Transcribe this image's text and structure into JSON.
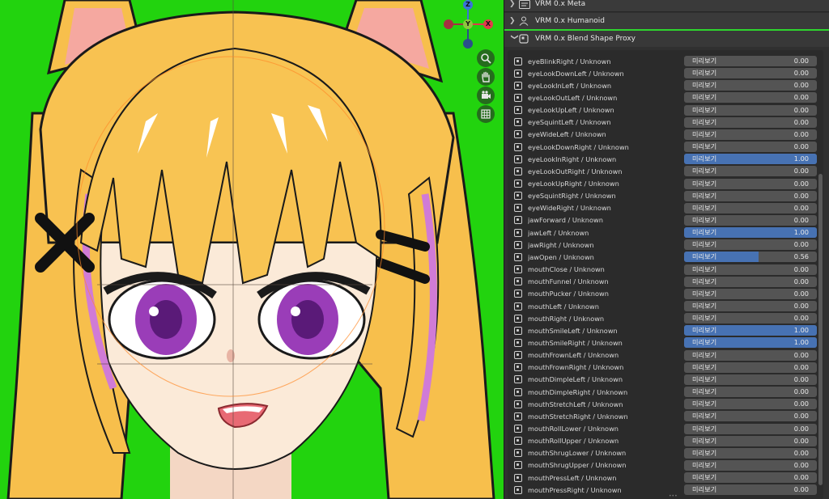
{
  "sections": [
    {
      "label": "VRM 0.x Meta",
      "expanded": false,
      "icon": "vrm-meta-icon"
    },
    {
      "label": "VRM 0.x Humanoid",
      "expanded": false,
      "icon": "humanoid-icon"
    },
    {
      "label": "VRM 0.x Blend Shape Proxy",
      "expanded": true,
      "icon": "blend-shape-icon"
    }
  ],
  "gizmo": {
    "z": "Z",
    "y": "Y",
    "x": "X"
  },
  "viewport_tools": [
    "zoom-icon",
    "hand-pan-icon",
    "camera-icon",
    "grid-icon"
  ],
  "slider_label": "미리보기",
  "blend_shapes": [
    {
      "name": "eyeBlinkRight / Unknown",
      "value": "0.00"
    },
    {
      "name": "eyeLookDownLeft / Unknown",
      "value": "0.00"
    },
    {
      "name": "eyeLookInLeft / Unknown",
      "value": "0.00"
    },
    {
      "name": "eyeLookOutLeft / Unknown",
      "value": "0.00"
    },
    {
      "name": "eyeLookUpLeft / Unknown",
      "value": "0.00"
    },
    {
      "name": "eyeSquintLeft / Unknown",
      "value": "0.00"
    },
    {
      "name": "eyeWideLeft / Unknown",
      "value": "0.00"
    },
    {
      "name": "eyeLookDownRight / Unknown",
      "value": "0.00"
    },
    {
      "name": "eyeLookInRight / Unknown",
      "value": "1.00"
    },
    {
      "name": "eyeLookOutRight / Unknown",
      "value": "0.00"
    },
    {
      "name": "eyeLookUpRight / Unknown",
      "value": "0.00"
    },
    {
      "name": "eyeSquintRight / Unknown",
      "value": "0.00"
    },
    {
      "name": "eyeWideRight / Unknown",
      "value": "0.00"
    },
    {
      "name": "jawForward / Unknown",
      "value": "0.00"
    },
    {
      "name": "jawLeft / Unknown",
      "value": "1.00"
    },
    {
      "name": "jawRight / Unknown",
      "value": "0.00"
    },
    {
      "name": "jawOpen / Unknown",
      "value": "0.56"
    },
    {
      "name": "mouthClose / Unknown",
      "value": "0.00"
    },
    {
      "name": "mouthFunnel / Unknown",
      "value": "0.00"
    },
    {
      "name": "mouthPucker / Unknown",
      "value": "0.00"
    },
    {
      "name": "mouthLeft / Unknown",
      "value": "0.00"
    },
    {
      "name": "mouthRight / Unknown",
      "value": "0.00"
    },
    {
      "name": "mouthSmileLeft / Unknown",
      "value": "1.00"
    },
    {
      "name": "mouthSmileRight / Unknown",
      "value": "1.00"
    },
    {
      "name": "mouthFrownLeft / Unknown",
      "value": "0.00"
    },
    {
      "name": "mouthFrownRight / Unknown",
      "value": "0.00"
    },
    {
      "name": "mouthDimpleLeft / Unknown",
      "value": "0.00"
    },
    {
      "name": "mouthDimpleRight / Unknown",
      "value": "0.00"
    },
    {
      "name": "mouthStretchLeft / Unknown",
      "value": "0.00"
    },
    {
      "name": "mouthStretchRight / Unknown",
      "value": "0.00"
    },
    {
      "name": "mouthRollLower / Unknown",
      "value": "0.00"
    },
    {
      "name": "mouthRollUpper / Unknown",
      "value": "0.00"
    },
    {
      "name": "mouthShrugLower / Unknown",
      "value": "0.00"
    },
    {
      "name": "mouthShrugUpper / Unknown",
      "value": "0.00"
    },
    {
      "name": "mouthPressLeft / Unknown",
      "value": "0.00"
    },
    {
      "name": "mouthPressRight / Unknown",
      "value": "0.00"
    }
  ],
  "colors": {
    "viewport_bg": "#22d30e",
    "slider_fill": "#4772b3",
    "slider_bg": "#545454",
    "panel_bg": "#303030",
    "section_active": "#2ed52e"
  }
}
